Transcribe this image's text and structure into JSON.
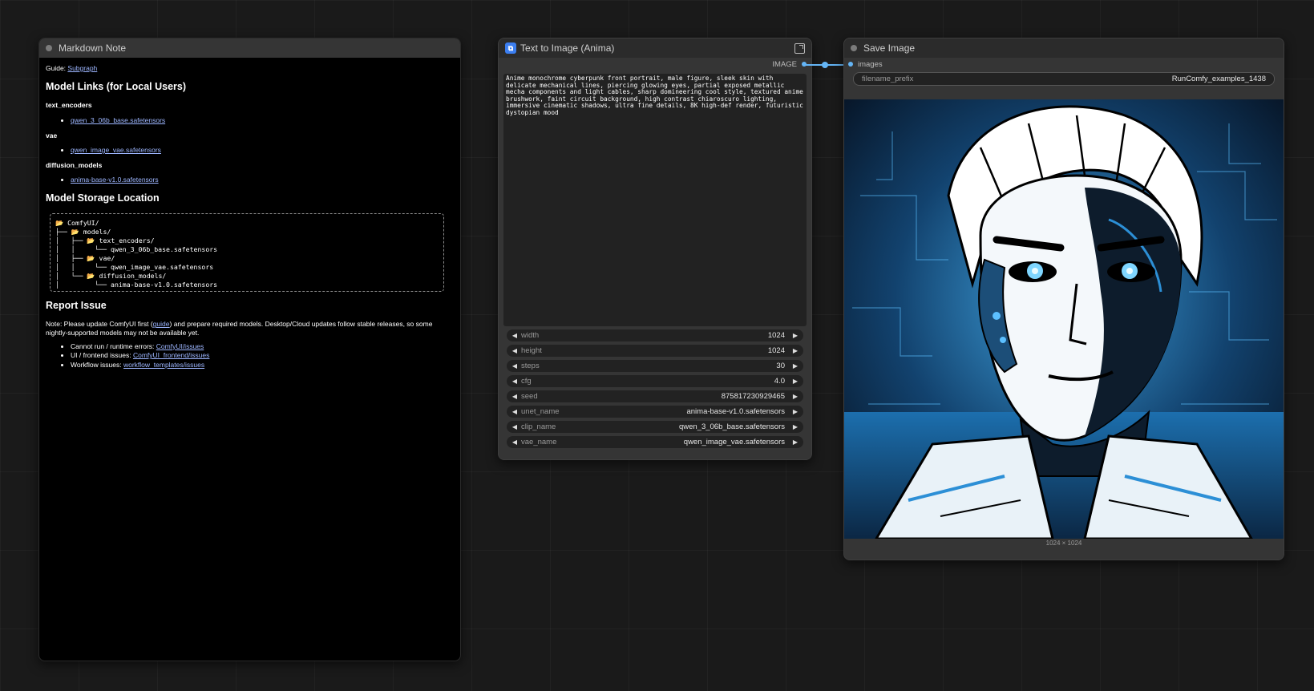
{
  "note": {
    "title": "Markdown Note",
    "guide_label": "Guide: ",
    "guide_link": "Subgraph",
    "h_links": "Model Links (for Local Users)",
    "h_text_encoders": "text_encoders",
    "text_encoders_link": "qwen_3_06b_base.safetensors",
    "h_vae": "vae",
    "vae_link": "qwen_image_vae.safetensors",
    "h_diffusion": "diffusion_models",
    "diffusion_link": "anima-base-v1.0.safetensors",
    "h_storage": "Model Storage Location",
    "tree": "📂 ComfyUI/\n├── 📂 models/\n│   ├── 📂 text_encoders/\n│   │     └── qwen_3_06b_base.safetensors\n│   ├── 📂 vae/\n│   │     └── qwen_image_vae.safetensors\n│   └── 📂 diffusion_models/\n│         └── anima-base-v1.0.safetensors",
    "h_report": "Report Issue",
    "note_pre": "Note: Please update ComfyUI first (",
    "note_link": "guide",
    "note_post": ") and prepare required models. Desktop/Cloud updates follow stable releases, so some nightly-supported models may not be available yet.",
    "issues": [
      {
        "label": "Cannot run / runtime errors: ",
        "link": "ComfyUI/issues"
      },
      {
        "label": "UI / frontend issues: ",
        "link": "ComfyUI_frontend/issues"
      },
      {
        "label": "Workflow issues: ",
        "link": "workflow_templates/issues"
      }
    ]
  },
  "t2i": {
    "title": "Text to Image (Anima)",
    "output_label": "IMAGE",
    "prompt": "Anime monochrome cyberpunk front portrait, male figure, sleek skin with delicate mechanical lines, piercing glowing eyes, partial exposed metallic mecha components and light cables, sharp domineering cool style, textured anime brushwork, faint circuit background, high contrast chiaroscuro lighting, immersive cinematic shadows, ultra fine details, 8K high-def render, futuristic dystopian mood",
    "widgets": [
      {
        "label": "width",
        "value": "1024"
      },
      {
        "label": "height",
        "value": "1024"
      },
      {
        "label": "steps",
        "value": "30"
      },
      {
        "label": "cfg",
        "value": "4.0"
      },
      {
        "label": "seed",
        "value": "875817230929465"
      },
      {
        "label": "unet_name",
        "value": "anima-base-v1.0.safetensors"
      },
      {
        "label": "clip_name",
        "value": "qwen_3_06b_base.safetensors"
      },
      {
        "label": "vae_name",
        "value": "qwen_image_vae.safetensors"
      }
    ]
  },
  "save": {
    "title": "Save Image",
    "input_label": "images",
    "prefix_label": "filename_prefix",
    "prefix_value": "RunComfy_examples_1438",
    "dims": "1024 × 1024"
  },
  "colors": {
    "link": "#64b5f6",
    "accent": "#3b7ef0"
  }
}
